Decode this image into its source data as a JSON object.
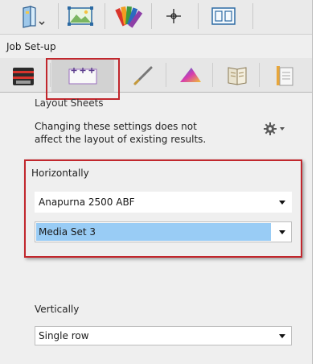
{
  "toolbar": {
    "buttons": [
      {
        "icon": "job-document-icon"
      },
      {
        "icon": "image-frame-icon"
      },
      {
        "icon": "color-swatch-book-icon"
      },
      {
        "icon": "crosshair-target-icon"
      },
      {
        "icon": "layout-preview-icon"
      }
    ]
  },
  "section": {
    "title": "Job Set-up"
  },
  "tabs": [
    {
      "icon": "printer-media-icon",
      "selected": false
    },
    {
      "icon": "layout-sheets-icon",
      "selected": true
    },
    {
      "icon": "pen-icon",
      "selected": false
    },
    {
      "icon": "color-triangle-icon",
      "selected": false
    },
    {
      "icon": "book-pages-icon",
      "selected": false
    },
    {
      "icon": "document-pages-icon",
      "selected": false
    }
  ],
  "layout_sheets": {
    "heading": "Layout Sheets",
    "info_line1": "Changing these settings does not",
    "info_line2": "affect the layout of existing results.",
    "gear_icon": "gear-icon"
  },
  "horizontally": {
    "label": "Horizontally",
    "printer": {
      "value": "Anapurna 2500 ABF"
    },
    "media_set": {
      "value": "Media Set 3"
    }
  },
  "vertically": {
    "label": "Vertically",
    "rows": {
      "value": "Single row"
    }
  },
  "colors": {
    "highlight_border": "#c1272d",
    "selection": "#99ccf5",
    "panel_bg": "#efefef"
  }
}
